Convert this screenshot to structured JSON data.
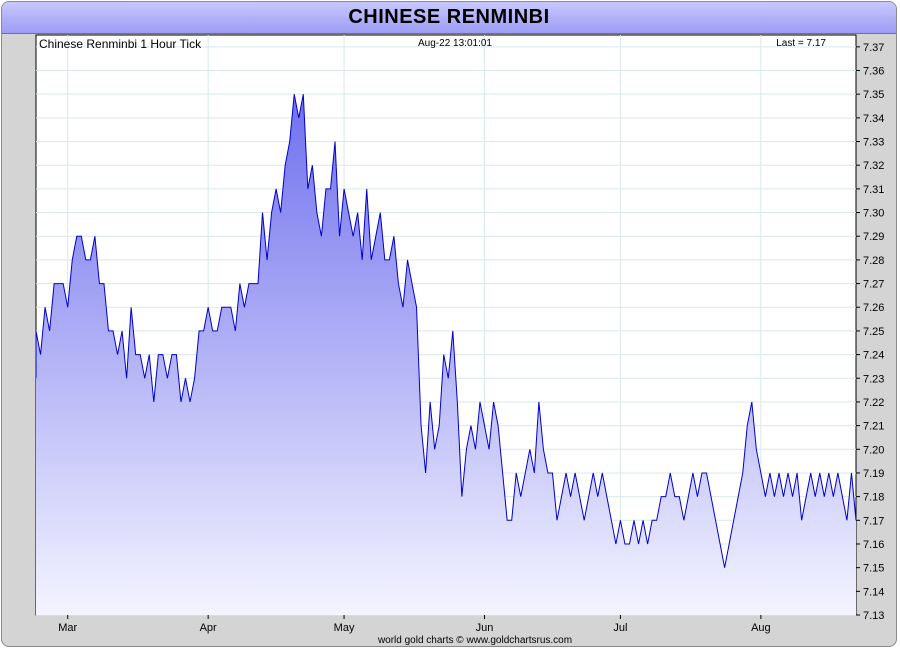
{
  "window": {
    "title": "CHINESE RENMINBI"
  },
  "chart_info": {
    "name": "Chinese Renminbi 1 Hour Tick",
    "timestamp": "Aug-22  13:01:01",
    "last": "Last = 7.17"
  },
  "footer": "world gold charts © www.goldchartsrus.com",
  "colors": {
    "line": "#0000cc",
    "fill_top": "#7070ee",
    "fill_bottom": "#f4f4ff",
    "grid": "#d9e9e9",
    "title_bg": "#b4b4fa"
  },
  "chart_data": {
    "type": "area",
    "title": "Chinese Renminbi 1 Hour Tick",
    "xlabel": "",
    "ylabel": "",
    "ylim": [
      7.13,
      7.375
    ],
    "yticks": [
      "7.13",
      "7.14",
      "7.15",
      "7.16",
      "7.17",
      "7.18",
      "7.19",
      "7.20",
      "7.21",
      "7.22",
      "7.23",
      "7.24",
      "7.25",
      "7.26",
      "7.27",
      "7.28",
      "7.29",
      "7.30",
      "7.31",
      "7.32",
      "7.33",
      "7.34",
      "7.35",
      "7.36",
      "7.37"
    ],
    "xlim": [
      "Feb-22",
      "Aug-22"
    ],
    "xticks": [
      {
        "label": "Mar",
        "date": "Mar-01"
      },
      {
        "label": "Apr",
        "date": "Apr-01"
      },
      {
        "label": "May",
        "date": "May-01"
      },
      {
        "label": "Jun",
        "date": "Jun-01"
      },
      {
        "label": "Jul",
        "date": "Jul-01"
      },
      {
        "label": "Aug",
        "date": "Aug-01"
      }
    ],
    "grid": true,
    "series": [
      {
        "points": [
          [
            "Feb-22",
            7.23
          ],
          [
            "Feb-22",
            7.25
          ],
          [
            "Feb-23",
            7.24
          ],
          [
            "Feb-24",
            7.26
          ],
          [
            "Feb-25",
            7.25
          ],
          [
            "Feb-26",
            7.27
          ],
          [
            "Feb-28",
            7.27
          ],
          [
            "Mar-01",
            7.26
          ],
          [
            "Mar-02",
            7.28
          ],
          [
            "Mar-03",
            7.29
          ],
          [
            "Mar-04",
            7.29
          ],
          [
            "Mar-05",
            7.28
          ],
          [
            "Mar-06",
            7.28
          ],
          [
            "Mar-07",
            7.29
          ],
          [
            "Mar-08",
            7.27
          ],
          [
            "Mar-09",
            7.27
          ],
          [
            "Mar-10",
            7.25
          ],
          [
            "Mar-11",
            7.25
          ],
          [
            "Mar-12",
            7.24
          ],
          [
            "Mar-13",
            7.25
          ],
          [
            "Mar-14",
            7.23
          ],
          [
            "Mar-15",
            7.26
          ],
          [
            "Mar-16",
            7.24
          ],
          [
            "Mar-17",
            7.24
          ],
          [
            "Mar-18",
            7.23
          ],
          [
            "Mar-19",
            7.24
          ],
          [
            "Mar-20",
            7.22
          ],
          [
            "Mar-21",
            7.24
          ],
          [
            "Mar-22",
            7.24
          ],
          [
            "Mar-23",
            7.23
          ],
          [
            "Mar-24",
            7.24
          ],
          [
            "Mar-25",
            7.24
          ],
          [
            "Mar-26",
            7.22
          ],
          [
            "Mar-27",
            7.23
          ],
          [
            "Mar-28",
            7.22
          ],
          [
            "Mar-29",
            7.23
          ],
          [
            "Mar-30",
            7.25
          ],
          [
            "Mar-31",
            7.25
          ],
          [
            "Apr-01",
            7.26
          ],
          [
            "Apr-02",
            7.25
          ],
          [
            "Apr-03",
            7.25
          ],
          [
            "Apr-04",
            7.26
          ],
          [
            "Apr-05",
            7.26
          ],
          [
            "Apr-06",
            7.26
          ],
          [
            "Apr-07",
            7.25
          ],
          [
            "Apr-08",
            7.27
          ],
          [
            "Apr-09",
            7.26
          ],
          [
            "Apr-10",
            7.27
          ],
          [
            "Apr-11",
            7.27
          ],
          [
            "Apr-12",
            7.27
          ],
          [
            "Apr-13",
            7.3
          ],
          [
            "Apr-14",
            7.28
          ],
          [
            "Apr-15",
            7.3
          ],
          [
            "Apr-16",
            7.31
          ],
          [
            "Apr-17",
            7.3
          ],
          [
            "Apr-18",
            7.32
          ],
          [
            "Apr-19",
            7.33
          ],
          [
            "Apr-20",
            7.35
          ],
          [
            "Apr-21",
            7.34
          ],
          [
            "Apr-22",
            7.35
          ],
          [
            "Apr-23",
            7.31
          ],
          [
            "Apr-24",
            7.32
          ],
          [
            "Apr-25",
            7.3
          ],
          [
            "Apr-26",
            7.29
          ],
          [
            "Apr-27",
            7.31
          ],
          [
            "Apr-28",
            7.31
          ],
          [
            "Apr-29",
            7.33
          ],
          [
            "Apr-30",
            7.29
          ],
          [
            "May-01",
            7.31
          ],
          [
            "May-02",
            7.3
          ],
          [
            "May-03",
            7.29
          ],
          [
            "May-04",
            7.3
          ],
          [
            "May-05",
            7.28
          ],
          [
            "May-06",
            7.31
          ],
          [
            "May-07",
            7.28
          ],
          [
            "May-08",
            7.29
          ],
          [
            "May-09",
            7.3
          ],
          [
            "May-10",
            7.28
          ],
          [
            "May-11",
            7.28
          ],
          [
            "May-12",
            7.29
          ],
          [
            "May-13",
            7.27
          ],
          [
            "May-14",
            7.26
          ],
          [
            "May-15",
            7.28
          ],
          [
            "May-16",
            7.27
          ],
          [
            "May-17",
            7.26
          ],
          [
            "May-18",
            7.21
          ],
          [
            "May-19",
            7.19
          ],
          [
            "May-20",
            7.22
          ],
          [
            "May-21",
            7.2
          ],
          [
            "May-22",
            7.21
          ],
          [
            "May-23",
            7.24
          ],
          [
            "May-24",
            7.23
          ],
          [
            "May-25",
            7.25
          ],
          [
            "May-26",
            7.22
          ],
          [
            "May-27",
            7.18
          ],
          [
            "May-28",
            7.2
          ],
          [
            "May-29",
            7.21
          ],
          [
            "May-30",
            7.2
          ],
          [
            "May-31",
            7.22
          ],
          [
            "Jun-01",
            7.21
          ],
          [
            "Jun-02",
            7.2
          ],
          [
            "Jun-03",
            7.22
          ],
          [
            "Jun-04",
            7.21
          ],
          [
            "Jun-05",
            7.19
          ],
          [
            "Jun-06",
            7.17
          ],
          [
            "Jun-07",
            7.17
          ],
          [
            "Jun-08",
            7.19
          ],
          [
            "Jun-09",
            7.18
          ],
          [
            "Jun-10",
            7.19
          ],
          [
            "Jun-11",
            7.2
          ],
          [
            "Jun-12",
            7.19
          ],
          [
            "Jun-13",
            7.22
          ],
          [
            "Jun-14",
            7.2
          ],
          [
            "Jun-15",
            7.19
          ],
          [
            "Jun-16",
            7.19
          ],
          [
            "Jun-17",
            7.17
          ],
          [
            "Jun-18",
            7.18
          ],
          [
            "Jun-19",
            7.19
          ],
          [
            "Jun-20",
            7.18
          ],
          [
            "Jun-21",
            7.19
          ],
          [
            "Jun-22",
            7.18
          ],
          [
            "Jun-23",
            7.17
          ],
          [
            "Jun-24",
            7.18
          ],
          [
            "Jun-25",
            7.19
          ],
          [
            "Jun-26",
            7.18
          ],
          [
            "Jun-27",
            7.19
          ],
          [
            "Jun-28",
            7.18
          ],
          [
            "Jun-29",
            7.17
          ],
          [
            "Jun-30",
            7.16
          ],
          [
            "Jul-01",
            7.17
          ],
          [
            "Jul-02",
            7.16
          ],
          [
            "Jul-03",
            7.16
          ],
          [
            "Jul-04",
            7.17
          ],
          [
            "Jul-05",
            7.16
          ],
          [
            "Jul-06",
            7.17
          ],
          [
            "Jul-07",
            7.16
          ],
          [
            "Jul-08",
            7.17
          ],
          [
            "Jul-09",
            7.17
          ],
          [
            "Jul-10",
            7.18
          ],
          [
            "Jul-11",
            7.18
          ],
          [
            "Jul-12",
            7.19
          ],
          [
            "Jul-13",
            7.18
          ],
          [
            "Jul-14",
            7.18
          ],
          [
            "Jul-15",
            7.17
          ],
          [
            "Jul-16",
            7.18
          ],
          [
            "Jul-17",
            7.19
          ],
          [
            "Jul-18",
            7.18
          ],
          [
            "Jul-19",
            7.19
          ],
          [
            "Jul-20",
            7.19
          ],
          [
            "Jul-21",
            7.18
          ],
          [
            "Jul-22",
            7.17
          ],
          [
            "Jul-23",
            7.16
          ],
          [
            "Jul-24",
            7.15
          ],
          [
            "Jul-25",
            7.16
          ],
          [
            "Jul-26",
            7.17
          ],
          [
            "Jul-27",
            7.18
          ],
          [
            "Jul-28",
            7.19
          ],
          [
            "Jul-29",
            7.21
          ],
          [
            "Jul-30",
            7.22
          ],
          [
            "Jul-31",
            7.2
          ],
          [
            "Aug-01",
            7.19
          ],
          [
            "Aug-02",
            7.18
          ],
          [
            "Aug-03",
            7.19
          ],
          [
            "Aug-04",
            7.18
          ],
          [
            "Aug-05",
            7.19
          ],
          [
            "Aug-06",
            7.18
          ],
          [
            "Aug-07",
            7.19
          ],
          [
            "Aug-08",
            7.18
          ],
          [
            "Aug-09",
            7.19
          ],
          [
            "Aug-10",
            7.17
          ],
          [
            "Aug-11",
            7.18
          ],
          [
            "Aug-12",
            7.19
          ],
          [
            "Aug-13",
            7.18
          ],
          [
            "Aug-14",
            7.19
          ],
          [
            "Aug-15",
            7.18
          ],
          [
            "Aug-16",
            7.19
          ],
          [
            "Aug-17",
            7.18
          ],
          [
            "Aug-18",
            7.19
          ],
          [
            "Aug-19",
            7.18
          ],
          [
            "Aug-20",
            7.17
          ],
          [
            "Aug-21",
            7.19
          ],
          [
            "Aug-22",
            7.17
          ]
        ]
      }
    ]
  }
}
